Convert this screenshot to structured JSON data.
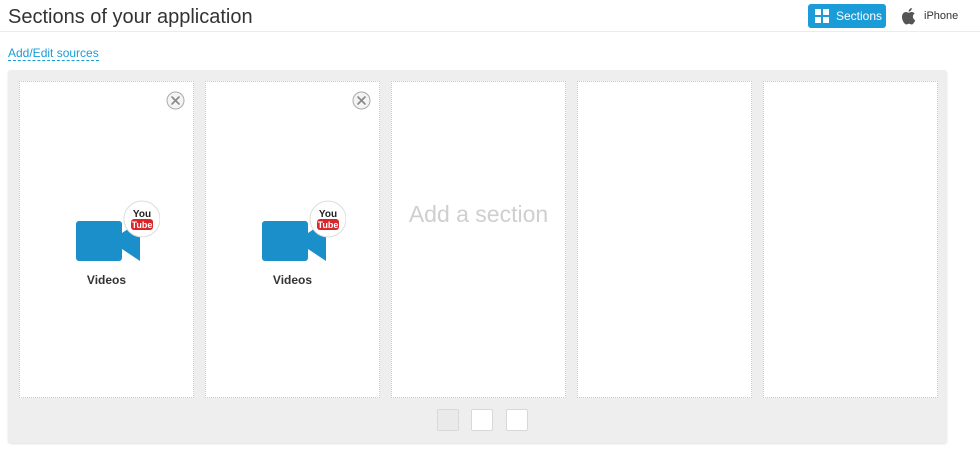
{
  "header": {
    "title": "Sections of your application",
    "sections_button": {
      "label": "Sections",
      "icon": "grid-icon",
      "color": "#1a9cd8"
    },
    "iphone_button": {
      "label": "iPhone",
      "icon": "apple-icon"
    }
  },
  "toolbar": {
    "add_edit_sources": "Add/Edit sources"
  },
  "sections": [
    {
      "label": "Videos",
      "icon": "youtube-video-camera-icon",
      "removable": true
    },
    {
      "label": "Videos",
      "icon": "youtube-video-camera-icon",
      "removable": true
    },
    {
      "label": "Add a section",
      "placeholder": true
    },
    {
      "label": "",
      "empty": true
    },
    {
      "label": "",
      "empty": true
    }
  ],
  "pagination": {
    "count": 3,
    "active_index": 0
  },
  "colors": {
    "accent": "#1a9cd8",
    "camera_blue": "#1a8fc9",
    "youtube_red": "#d8262b",
    "placeholder_text": "#cfcfcf"
  }
}
